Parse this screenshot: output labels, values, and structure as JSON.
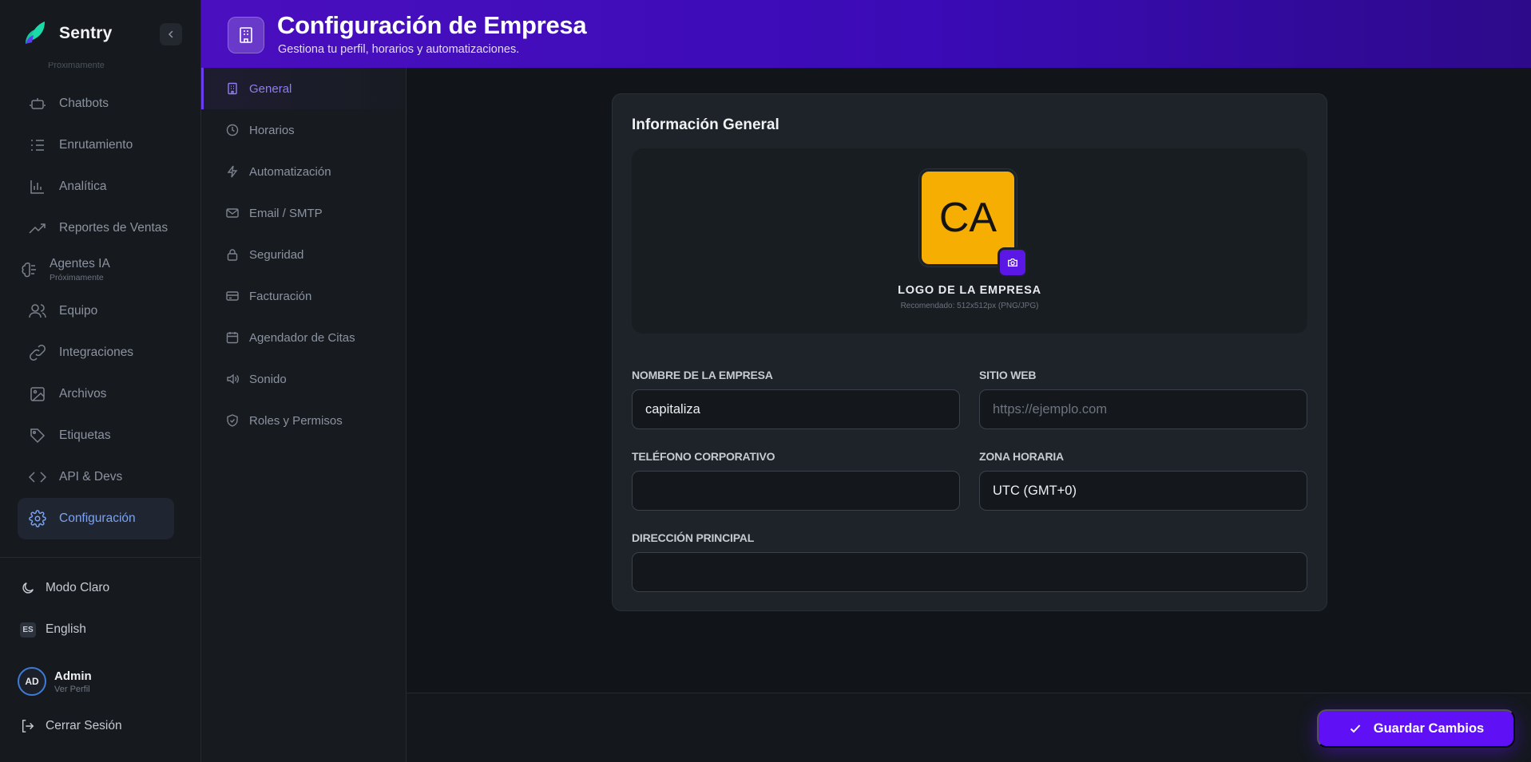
{
  "app": {
    "name": "Sentry"
  },
  "sidebar": {
    "cut_label": "Próximamente",
    "items": [
      {
        "label": "Chatbots",
        "icon": "bot-icon"
      },
      {
        "label": "Enrutamiento",
        "icon": "list-route-icon"
      },
      {
        "label": "Analítica",
        "icon": "bar-chart-icon"
      },
      {
        "label": "Reportes de Ventas",
        "icon": "trend-up-icon"
      },
      {
        "label": "Agentes IA",
        "sub": "Próximamente",
        "icon": "brain-icon"
      },
      {
        "label": "Equipo",
        "icon": "users-icon"
      },
      {
        "label": "Integraciones",
        "icon": "link-icon"
      },
      {
        "label": "Archivos",
        "icon": "image-icon"
      },
      {
        "label": "Etiquetas",
        "icon": "tag-icon"
      },
      {
        "label": "API & Devs",
        "icon": "code-icon"
      },
      {
        "label": "Configuración",
        "icon": "gear-icon",
        "active": true
      }
    ],
    "theme_toggle": "Modo Claro",
    "language_badge": "ES",
    "language": "English",
    "user": {
      "initials": "AD",
      "name": "Admin",
      "sub": "Ver Perfil"
    },
    "logout": "Cerrar Sesión"
  },
  "header": {
    "title": "Configuración de Empresa",
    "subtitle": "Gestiona tu perfil, horarios y automatizaciones."
  },
  "settings_nav": [
    {
      "label": "General",
      "icon": "building-icon",
      "active": true
    },
    {
      "label": "Horarios",
      "icon": "clock-icon"
    },
    {
      "label": "Automatización",
      "icon": "bolt-icon"
    },
    {
      "label": "Email / SMTP",
      "icon": "mail-icon"
    },
    {
      "label": "Seguridad",
      "icon": "lock-icon"
    },
    {
      "label": "Facturación",
      "icon": "credit-card-icon"
    },
    {
      "label": "Agendador de Citas",
      "icon": "calendar-icon"
    },
    {
      "label": "Sonido",
      "icon": "speaker-icon"
    },
    {
      "label": "Roles y Permisos",
      "icon": "shield-icon"
    }
  ],
  "card": {
    "title": "Información General",
    "logo": {
      "initials": "CA",
      "label": "LOGO DE LA EMPRESA",
      "hint": "Recomendado: 512x512px (PNG/JPG)",
      "color": "#f6ae03"
    },
    "fields": {
      "company_name": {
        "label": "NOMBRE DE LA EMPRESA",
        "value": "capitaliza",
        "placeholder": ""
      },
      "website": {
        "label": "SITIO WEB",
        "value": "",
        "placeholder": "https://ejemplo.com"
      },
      "phone": {
        "label": "TELÉFONO CORPORATIVO",
        "value": "",
        "placeholder": ""
      },
      "timezone": {
        "label": "ZONA HORARIA",
        "value": "UTC (GMT+0)"
      },
      "address": {
        "label": "DIRECCIÓN PRINCIPAL",
        "value": "",
        "placeholder": ""
      }
    }
  },
  "actions": {
    "save": "Guardar Cambios"
  },
  "colors": {
    "accent": "#6010f5",
    "active_nav": "#7ba3f2",
    "header_gradient_start": "#4a0fbf"
  }
}
